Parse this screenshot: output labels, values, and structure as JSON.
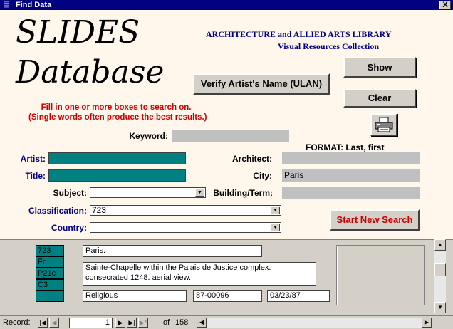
{
  "window": {
    "title": "Find Data",
    "close_glyph": "X"
  },
  "header": {
    "title_line1": "SLIDES",
    "title_line2": "Database",
    "library_line1": "ARCHITECTURE and ALLIED ARTS LIBRARY",
    "library_line2": "Visual Resources Collection"
  },
  "buttons": {
    "verify": "Verify Artist's Name (ULAN)",
    "show": "Show",
    "clear": "Clear",
    "start_new_search": "Start New Search"
  },
  "instructions": {
    "line1": "Fill in one or more boxes to search on.",
    "line2": "(Single words often produce the best results.)"
  },
  "format_note": "FORMAT: Last, first",
  "fields": {
    "keyword": {
      "label": "Keyword:",
      "value": ""
    },
    "artist": {
      "label": "Artist:",
      "value": ""
    },
    "title": {
      "label": "Title:",
      "value": ""
    },
    "subject": {
      "label": "Subject:",
      "value": ""
    },
    "classification": {
      "label": "Classification:",
      "value": "723"
    },
    "country": {
      "label": "Country:",
      "value": ""
    },
    "architect": {
      "label": "Architect:",
      "value": ""
    },
    "city": {
      "label": "City:",
      "value": "Paris"
    },
    "building_term": {
      "label": "Building/Term:",
      "value": ""
    }
  },
  "record": {
    "codes": [
      "723",
      "Fr",
      "P21c",
      "C3",
      ""
    ],
    "city": "Paris.",
    "description": "Sainte-Chapelle within the Palais de Justice complex. consecrated 1248. aerial view.",
    "category": "Religious",
    "id": "87-00096",
    "date": "03/23/87"
  },
  "navigation": {
    "record_label": "Record:",
    "current": "1",
    "of_label": "of",
    "total": "158"
  },
  "icons": {
    "printer": "printer-icon",
    "first": "first-record-icon",
    "prev": "prev-record-icon",
    "next": "next-record-icon",
    "last": "last-record-icon",
    "new": "new-record-icon"
  }
}
